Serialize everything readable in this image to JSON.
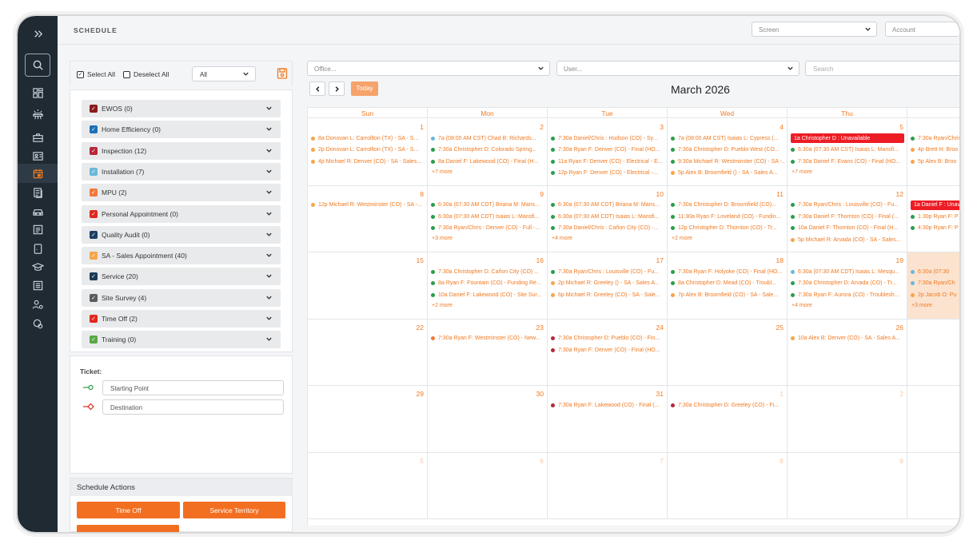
{
  "header": {
    "title": "SCHEDULE",
    "screen_placeholder": "Screen",
    "account_placeholder": "Account"
  },
  "left": {
    "select_all": "Select All",
    "deselect_all": "Deselect All",
    "filter_value": "All",
    "categories": [
      {
        "label": "EWOS (0)",
        "color": "#8b1a1a"
      },
      {
        "label": "Home Efficiency (0)",
        "color": "#1f6fb5"
      },
      {
        "label": "Inspection (12)",
        "color": "#b5283a"
      },
      {
        "label": "Installation (7)",
        "color": "#6ab7d8"
      },
      {
        "label": "MPU (2)",
        "color": "#f07a3a"
      },
      {
        "label": "Personal Appointment (0)",
        "color": "#e0281e"
      },
      {
        "label": "Quality Audit (0)",
        "color": "#1c3f66"
      },
      {
        "label": "SA - Sales Appointment (40)",
        "color": "#f6a54a"
      },
      {
        "label": "Service (20)",
        "color": "#1b3a57"
      },
      {
        "label": "Site Survey (4)",
        "color": "#5c5c5c"
      },
      {
        "label": "Time Off (2)",
        "color": "#e0281e"
      },
      {
        "label": "Training (0)",
        "color": "#5aa845"
      }
    ],
    "ticket_label": "Ticket:",
    "starting_point": "Starting Point",
    "destination": "Destination",
    "actions_title": "Schedule Actions",
    "time_off_button": "Time Off",
    "service_territory_button": "Service Territory"
  },
  "calendar": {
    "office_placeholder": "Office...",
    "user_placeholder": "User...",
    "search_placeholder": "Search",
    "today_label": "Today",
    "month_title": "March 2026",
    "days_of_week": [
      "Sun",
      "Mon",
      "Tue",
      "Wed",
      "Thu",
      "Fri"
    ],
    "weeks": [
      [
        {
          "n": "1",
          "ev": [
            {
              "t": "8a Donovan L: Carrollton (TX) - SA - S...",
              "c": "#f6a54a"
            },
            {
              "t": "2p Donovan L: Carrollton (TX) - SA - S...",
              "c": "#f6a54a"
            },
            {
              "t": "4p Michael R: Denver (CO) - SA - Sales...",
              "c": "#f6a54a"
            }
          ]
        },
        {
          "n": "2",
          "ev": [
            {
              "t": "7a (08:00 AM CST) Chad B: Richards...",
              "c": "#6ab7d8"
            },
            {
              "t": "7:30a Christopher D: Colorado Spring...",
              "c": "#2a9d4a"
            },
            {
              "t": "8a Daniel F: Lakewood (CO) - Final (H...",
              "c": "#2a9d4a"
            }
          ],
          "more": "+7 more"
        },
        {
          "n": "3",
          "ev": [
            {
              "t": "7:30a Daniel/Chris : Hudson (CO) - Sy...",
              "c": "#2a9d4a"
            },
            {
              "t": "7:30a Ryan F: Denver (CO) - Final (HO...",
              "c": "#2a9d4a"
            },
            {
              "t": "11a Ryan F: Denver (CO) - Electrical - E...",
              "c": "#2a9d4a"
            },
            {
              "t": "12p Ryan F: Denver (CO) - Electrical -...",
              "c": "#2a9d4a"
            }
          ]
        },
        {
          "n": "4",
          "ev": [
            {
              "t": "7a (08:00 AM CST) Isaias L: Cypress (...",
              "c": "#2a9d4a"
            },
            {
              "t": "7:30a Christopher D: Pueblo West (CO...",
              "c": "#2a9d4a"
            },
            {
              "t": "9:30a Michael R: Westminster (CO) - SA -...",
              "c": "#2a9d4a"
            },
            {
              "t": "5p Alex B: Broomfield () - SA - Sales A...",
              "c": "#f6a54a"
            }
          ]
        },
        {
          "n": "5",
          "ev": [
            {
              "t": "1a Christopher D : Unavailable",
              "c": "red"
            },
            {
              "t": "6:30a (07:30 AM CST) Isaias L: Mansfi...",
              "c": "#2a9d4a"
            },
            {
              "t": "7:30a Daniel F: Evans (CO) - Final (HO...",
              "c": "#2a9d4a"
            }
          ],
          "more": "+7 more"
        },
        {
          "n": "",
          "ev": [
            {
              "t": "7:30a Ryan/Chris",
              "c": "#2a9d4a"
            },
            {
              "t": "4p Brett H: Broo",
              "c": "#f6a54a"
            },
            {
              "t": "5p Alex B: Broo",
              "c": "#f6a54a"
            }
          ]
        }
      ],
      [
        {
          "n": "8",
          "ev": [
            {
              "t": "12p Michael R: Westminster (CO) - SA -...",
              "c": "#f6a54a"
            }
          ]
        },
        {
          "n": "9",
          "ev": [
            {
              "t": "6:30a (07:30 AM CDT) Briana M: Mans...",
              "c": "#2a9d4a"
            },
            {
              "t": "6:30a (07:30 AM CDT) Isaias L: Mansfi...",
              "c": "#2a9d4a"
            },
            {
              "t": "7:30a Ryan/Chris : Denver (CO) - Full -...",
              "c": "#2a9d4a"
            }
          ],
          "more": "+3 more"
        },
        {
          "n": "10",
          "ev": [
            {
              "t": "6:30a (07:30 AM CDT) Briana M: Mans...",
              "c": "#2a9d4a"
            },
            {
              "t": "6:30a (07:30 AM CDT) Isaias L: Mansfi...",
              "c": "#2a9d4a"
            },
            {
              "t": "7:30a Daniel/Chris : Cañon City (CO) -...",
              "c": "#2a9d4a"
            }
          ],
          "more": "+4 more"
        },
        {
          "n": "11",
          "ev": [
            {
              "t": "7:30a Christopher D: Broomfield (CO)...",
              "c": "#2a9d4a"
            },
            {
              "t": "11:30a Ryan F: Loveland (CO) - Fundin...",
              "c": "#2a9d4a"
            },
            {
              "t": "12p Christopher D: Thornton (CO) - Tr...",
              "c": "#2a9d4a"
            }
          ],
          "more": "+2 more"
        },
        {
          "n": "12",
          "ev": [
            {
              "t": "7:30a Ryan/Chris : Louisville (CO) - Fu...",
              "c": "#2a9d4a"
            },
            {
              "t": "7:30a Daniel F: Thornton (CO) - Final (...",
              "c": "#2a9d4a"
            },
            {
              "t": "10a Daniel F: Thornton (CO) - Final (H...",
              "c": "#2a9d4a"
            },
            {
              "t": "5p Michael R: Arvada (CO) - SA - Sales...",
              "c": "#f6a54a"
            }
          ]
        },
        {
          "n": "",
          "ev": [
            {
              "t": "1a Daniel F : Unava",
              "c": "red"
            },
            {
              "t": "1:30p Ryan F: P",
              "c": "#2a9d4a"
            },
            {
              "t": "4:30p Ryan F: P",
              "c": "#2a9d4a"
            }
          ]
        }
      ],
      [
        {
          "n": "15",
          "ev": []
        },
        {
          "n": "16",
          "ev": [
            {
              "t": "7:30a Christopher D: Cañon City (CO) ...",
              "c": "#2a9d4a"
            },
            {
              "t": "8a Ryan F: Fountain (CO) - Funding Re...",
              "c": "#2a9d4a"
            },
            {
              "t": "10a Daniel F: Lakewood (CO) - Site Sur...",
              "c": "#2a9d4a"
            }
          ],
          "more": "+2 more"
        },
        {
          "n": "17",
          "ev": [
            {
              "t": "7:30a Ryan/Chris : Louisville (CO) - Fu...",
              "c": "#2a9d4a"
            },
            {
              "t": "2p Michael R: Greeley () - SA - Sales A...",
              "c": "#f6a54a"
            },
            {
              "t": "6p Michael R: Greeley (CO) - SA - Sale...",
              "c": "#f6a54a"
            }
          ]
        },
        {
          "n": "18",
          "ev": [
            {
              "t": "7:30a Ryan F: Holyoke (CO) - Final (HO...",
              "c": "#2a9d4a"
            },
            {
              "t": "8a Christopher D: Mead (CO) - Troubl...",
              "c": "#2a9d4a"
            },
            {
              "t": "7p Alex B: Broomfield (CO) - SA - Sale...",
              "c": "#f6a54a"
            }
          ]
        },
        {
          "n": "19",
          "ev": [
            {
              "t": "6:30a (07:30 AM CDT) Isaias L: Mesqu...",
              "c": "#6ab7d8"
            },
            {
              "t": "7:30a Christopher D: Arvada (CO) - Tr...",
              "c": "#2a9d4a"
            },
            {
              "t": "7:30a Ryan F: Aurora (CO) - Troublesh...",
              "c": "#2a9d4a"
            }
          ],
          "more": "+4 more"
        },
        {
          "n": "",
          "today": true,
          "ev": [
            {
              "t": "6:30a (07:30",
              "c": "#6ab7d8"
            },
            {
              "t": "7:30a Ryan/Ch",
              "c": "#6ab7d8"
            },
            {
              "t": "2p Jacob O: Pu",
              "c": "#f6a54a"
            }
          ],
          "more": "+3 more"
        }
      ],
      [
        {
          "n": "22",
          "ev": []
        },
        {
          "n": "23",
          "ev": [
            {
              "t": "7:30a Ryan F: Westminster (CO) - New...",
              "c": "#f07a3a"
            }
          ]
        },
        {
          "n": "24",
          "ev": [
            {
              "t": "7:30a Christopher D: Pueblo (CO) - Fin...",
              "c": "#b5283a"
            },
            {
              "t": "7:30a Ryan F: Denver (CO) - Final (HO...",
              "c": "#b5283a"
            }
          ]
        },
        {
          "n": "25",
          "ev": []
        },
        {
          "n": "26",
          "ev": [
            {
              "t": "10a Alex B: Denver (CO) - SA - Sales A...",
              "c": "#f6a54a"
            }
          ]
        },
        {
          "n": "",
          "ev": []
        }
      ],
      [
        {
          "n": "29",
          "ev": []
        },
        {
          "n": "30",
          "ev": []
        },
        {
          "n": "31",
          "ev": [
            {
              "t": "7:30a Ryan F: Lakewood (CO) - Final (...",
              "c": "#b5283a"
            }
          ]
        },
        {
          "n": "1",
          "other": true,
          "ev": [
            {
              "t": "7:30a Christopher D: Greeley (CO) - Fi...",
              "c": "#b5283a"
            }
          ]
        },
        {
          "n": "2",
          "other": true,
          "ev": []
        },
        {
          "n": "",
          "ev": []
        }
      ],
      [
        {
          "n": "5",
          "other": true,
          "ev": []
        },
        {
          "n": "6",
          "other": true,
          "ev": []
        },
        {
          "n": "7",
          "other": true,
          "ev": []
        },
        {
          "n": "8",
          "other": true,
          "ev": []
        },
        {
          "n": "9",
          "other": true,
          "ev": []
        },
        {
          "n": "",
          "ev": []
        }
      ]
    ]
  },
  "legend": [
    {
      "label": "Inspection",
      "color": "#b5283a"
    },
    {
      "label": "Installation",
      "color": "#6ab7d8"
    },
    {
      "label": "MPU",
      "color": "#f07a3a"
    },
    {
      "label": "SA - Sales Appointment",
      "color": "#f6a54a"
    },
    {
      "label": "Service",
      "color": "#1b3a57"
    }
  ]
}
